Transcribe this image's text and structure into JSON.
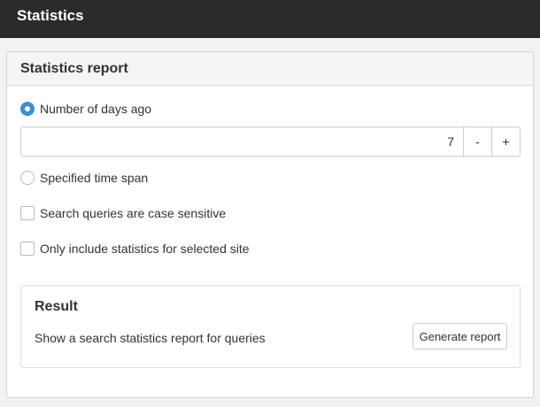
{
  "header": {
    "title": "Statistics"
  },
  "panel": {
    "title": "Statistics report",
    "days_option": {
      "label": "Number of days ago",
      "selected": true
    },
    "days_stepper": {
      "value": "7",
      "decrement_label": "-",
      "increment_label": "+"
    },
    "timespan_option": {
      "label": "Specified time span",
      "selected": false
    },
    "case_sensitive": {
      "label": "Search queries are case sensitive",
      "checked": false
    },
    "selected_site": {
      "label": "Only include statistics for selected site",
      "checked": false
    }
  },
  "result": {
    "title": "Result",
    "description": "Show a search statistics report for queries",
    "button_label": "Generate report"
  },
  "colors": {
    "accent": "#3a8fd6",
    "topbar": "#2b2b2b"
  }
}
